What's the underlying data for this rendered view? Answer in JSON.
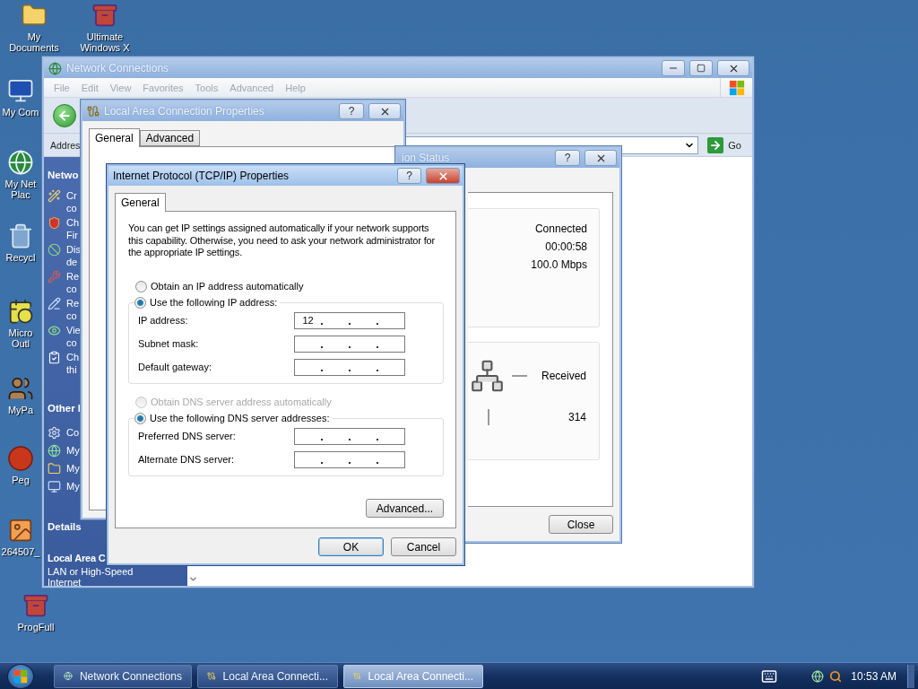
{
  "desktop_icons": [
    {
      "kind": "folder",
      "lines": [
        "My",
        "Documents"
      ]
    },
    {
      "kind": "archive",
      "lines": [
        "Ultimate",
        "Windows X"
      ]
    },
    {
      "kind": "computer",
      "lines": [
        "My Com"
      ]
    },
    {
      "kind": "network",
      "lines": [
        "My Net",
        "Plac"
      ]
    },
    {
      "kind": "recycle",
      "lines": [
        "Recycl"
      ]
    },
    {
      "kind": "calendar",
      "lines": [
        "Micro",
        "Outl"
      ]
    },
    {
      "kind": "people",
      "lines": [
        "MyPa"
      ]
    },
    {
      "kind": "ball",
      "lines": [
        "Peg"
      ]
    },
    {
      "kind": "image",
      "lines": [
        "264507_"
      ]
    },
    {
      "kind": "archive",
      "lines": [
        "ProgFull"
      ]
    }
  ],
  "network_connections": {
    "title": "Network Connections",
    "menu": [
      "File",
      "Edit",
      "View",
      "Favorites",
      "Tools",
      "Advanced",
      "Help"
    ],
    "address_label": "Addres",
    "go_label": "Go",
    "sidebar": [
      {
        "title": "Netwo",
        "items": [
          {
            "kind": "wizard",
            "lines": [
              "Cr",
              "co"
            ]
          },
          {
            "kind": "firewall",
            "lines": [
              "Ch",
              "Fir"
            ]
          },
          {
            "kind": "disable",
            "lines": [
              "Dis",
              "de"
            ]
          },
          {
            "kind": "repair",
            "lines": [
              "Re",
              "co"
            ]
          },
          {
            "kind": "rename",
            "lines": [
              "Re",
              "co"
            ]
          },
          {
            "kind": "view",
            "lines": [
              "Vie",
              "co"
            ]
          },
          {
            "kind": "change",
            "lines": [
              "Ch",
              "thi"
            ]
          }
        ]
      },
      {
        "title": "Other I",
        "items": [
          {
            "kind": "control",
            "lines": [
              "Co"
            ]
          },
          {
            "kind": "network",
            "lines": [
              "My"
            ]
          },
          {
            "kind": "folder",
            "lines": [
              "My"
            ]
          },
          {
            "kind": "computer",
            "lines": [
              "My"
            ]
          }
        ]
      }
    ],
    "details": {
      "title": "Details",
      "name": "Local Area C",
      "type_lines": [
        "LAN or High-Speed",
        "Internet"
      ]
    }
  },
  "lac_properties": {
    "title": "Local Area Connection Properties",
    "help": "?",
    "tabs": [
      {
        "label": "General",
        "selected": true
      },
      {
        "label": "Advanced",
        "selected": false
      }
    ]
  },
  "status_window": {
    "title": "ion Status",
    "help": "?",
    "status": "Connected",
    "duration": "00:00:58",
    "speed": "100.0 Mbps",
    "activity_label": "Received",
    "received": "314",
    "close_label": "Close"
  },
  "tcpip": {
    "title": "Internet Protocol (TCP/IP) Properties",
    "help": "?",
    "tabs": [
      {
        "label": "General",
        "selected": true
      }
    ],
    "intro": "You can get IP settings assigned automatically if your network supports this capability. Otherwise, you need to ask your network administrator for the appropriate IP settings.",
    "ip_auto": {
      "label": "Obtain an IP address automatically",
      "selected": false,
      "disabled": false
    },
    "ip_manual": {
      "label": "Use the following IP address:",
      "selected": true,
      "disabled": false
    },
    "ip_fields": [
      {
        "label": "IP address:",
        "octets": [
          "12"
        ]
      },
      {
        "label": "Subnet mask:"
      },
      {
        "label": "Default gateway:"
      }
    ],
    "dns_auto": {
      "label": "Obtain DNS server address automatically",
      "selected": false,
      "disabled": true
    },
    "dns_manual": {
      "label": "Use the following DNS server addresses:",
      "selected": true,
      "disabled": false
    },
    "dns_fields": [
      {
        "label": "Preferred DNS server:"
      },
      {
        "label": "Alternate DNS server:"
      }
    ],
    "advanced_label": "Advanced...",
    "ok_label": "OK",
    "cancel_label": "Cancel"
  },
  "taskbar": {
    "buttons": [
      {
        "kind": "network",
        "label": "Network Connections",
        "selected": false
      },
      {
        "kind": "connection",
        "label": "Local Area Connecti...",
        "selected": false
      },
      {
        "kind": "connection",
        "label": "Local Area Connecti...",
        "selected": true
      }
    ],
    "clock": "10:53 AM"
  }
}
